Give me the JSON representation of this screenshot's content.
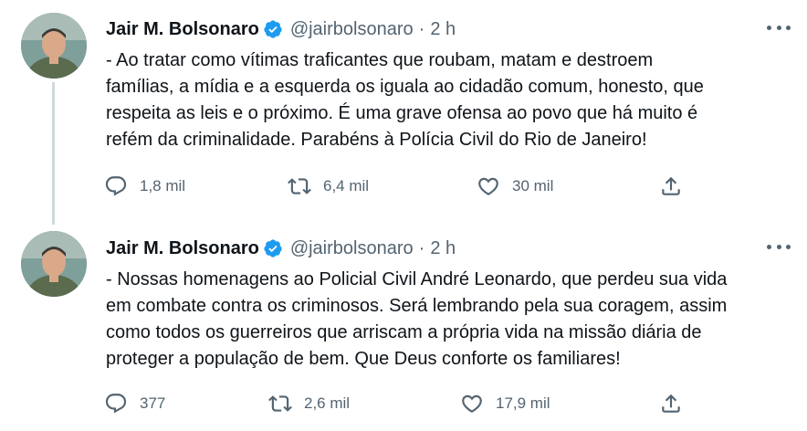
{
  "tweets": [
    {
      "author": {
        "name": "Jair M. Bolsonaro",
        "handle": "@jairbolsonaro",
        "verified": true
      },
      "time": "2 h",
      "separator": "·",
      "text": "- Ao tratar como vítimas traficantes que roubam, matam e destroem\nfamílias, a mídia e a esquerda os iguala ao cidadão comum, honesto, que\nrespeita as leis e o próximo. É uma grave ofensa ao povo que há muito é\nrefém da criminalidade. Parabéns à Polícia Civil do Rio de Janeiro!",
      "stats": {
        "replies": "1,8 mil",
        "retweets": "6,4 mil",
        "likes": "30 mil"
      }
    },
    {
      "author": {
        "name": "Jair M. Bolsonaro",
        "handle": "@jairbolsonaro",
        "verified": true
      },
      "time": "2 h",
      "separator": "·",
      "text": "- Nossas homenagens ao Policial Civil André Leonardo, que perdeu sua vida\nem combate contra os criminosos. Será lembrando pela sua coragem, assim\ncomo todos os guerreiros que arriscam a própria vida na missão diária de\nproteger a população de bem. Que Deus conforte os familiares!",
      "stats": {
        "replies": "377",
        "retweets": "2,6 mil",
        "likes": "17,9 mil"
      }
    }
  ],
  "icons": {
    "reply": "reply-icon",
    "retweet": "retweet-icon",
    "like": "heart-icon",
    "share": "share-icon",
    "more": "more-options-icon",
    "verified": "verified-badge-icon"
  },
  "colors": {
    "verified": "#1d9bf0",
    "text": "#0f1419",
    "secondary": "#536471",
    "thread_line": "#cfd9de"
  }
}
